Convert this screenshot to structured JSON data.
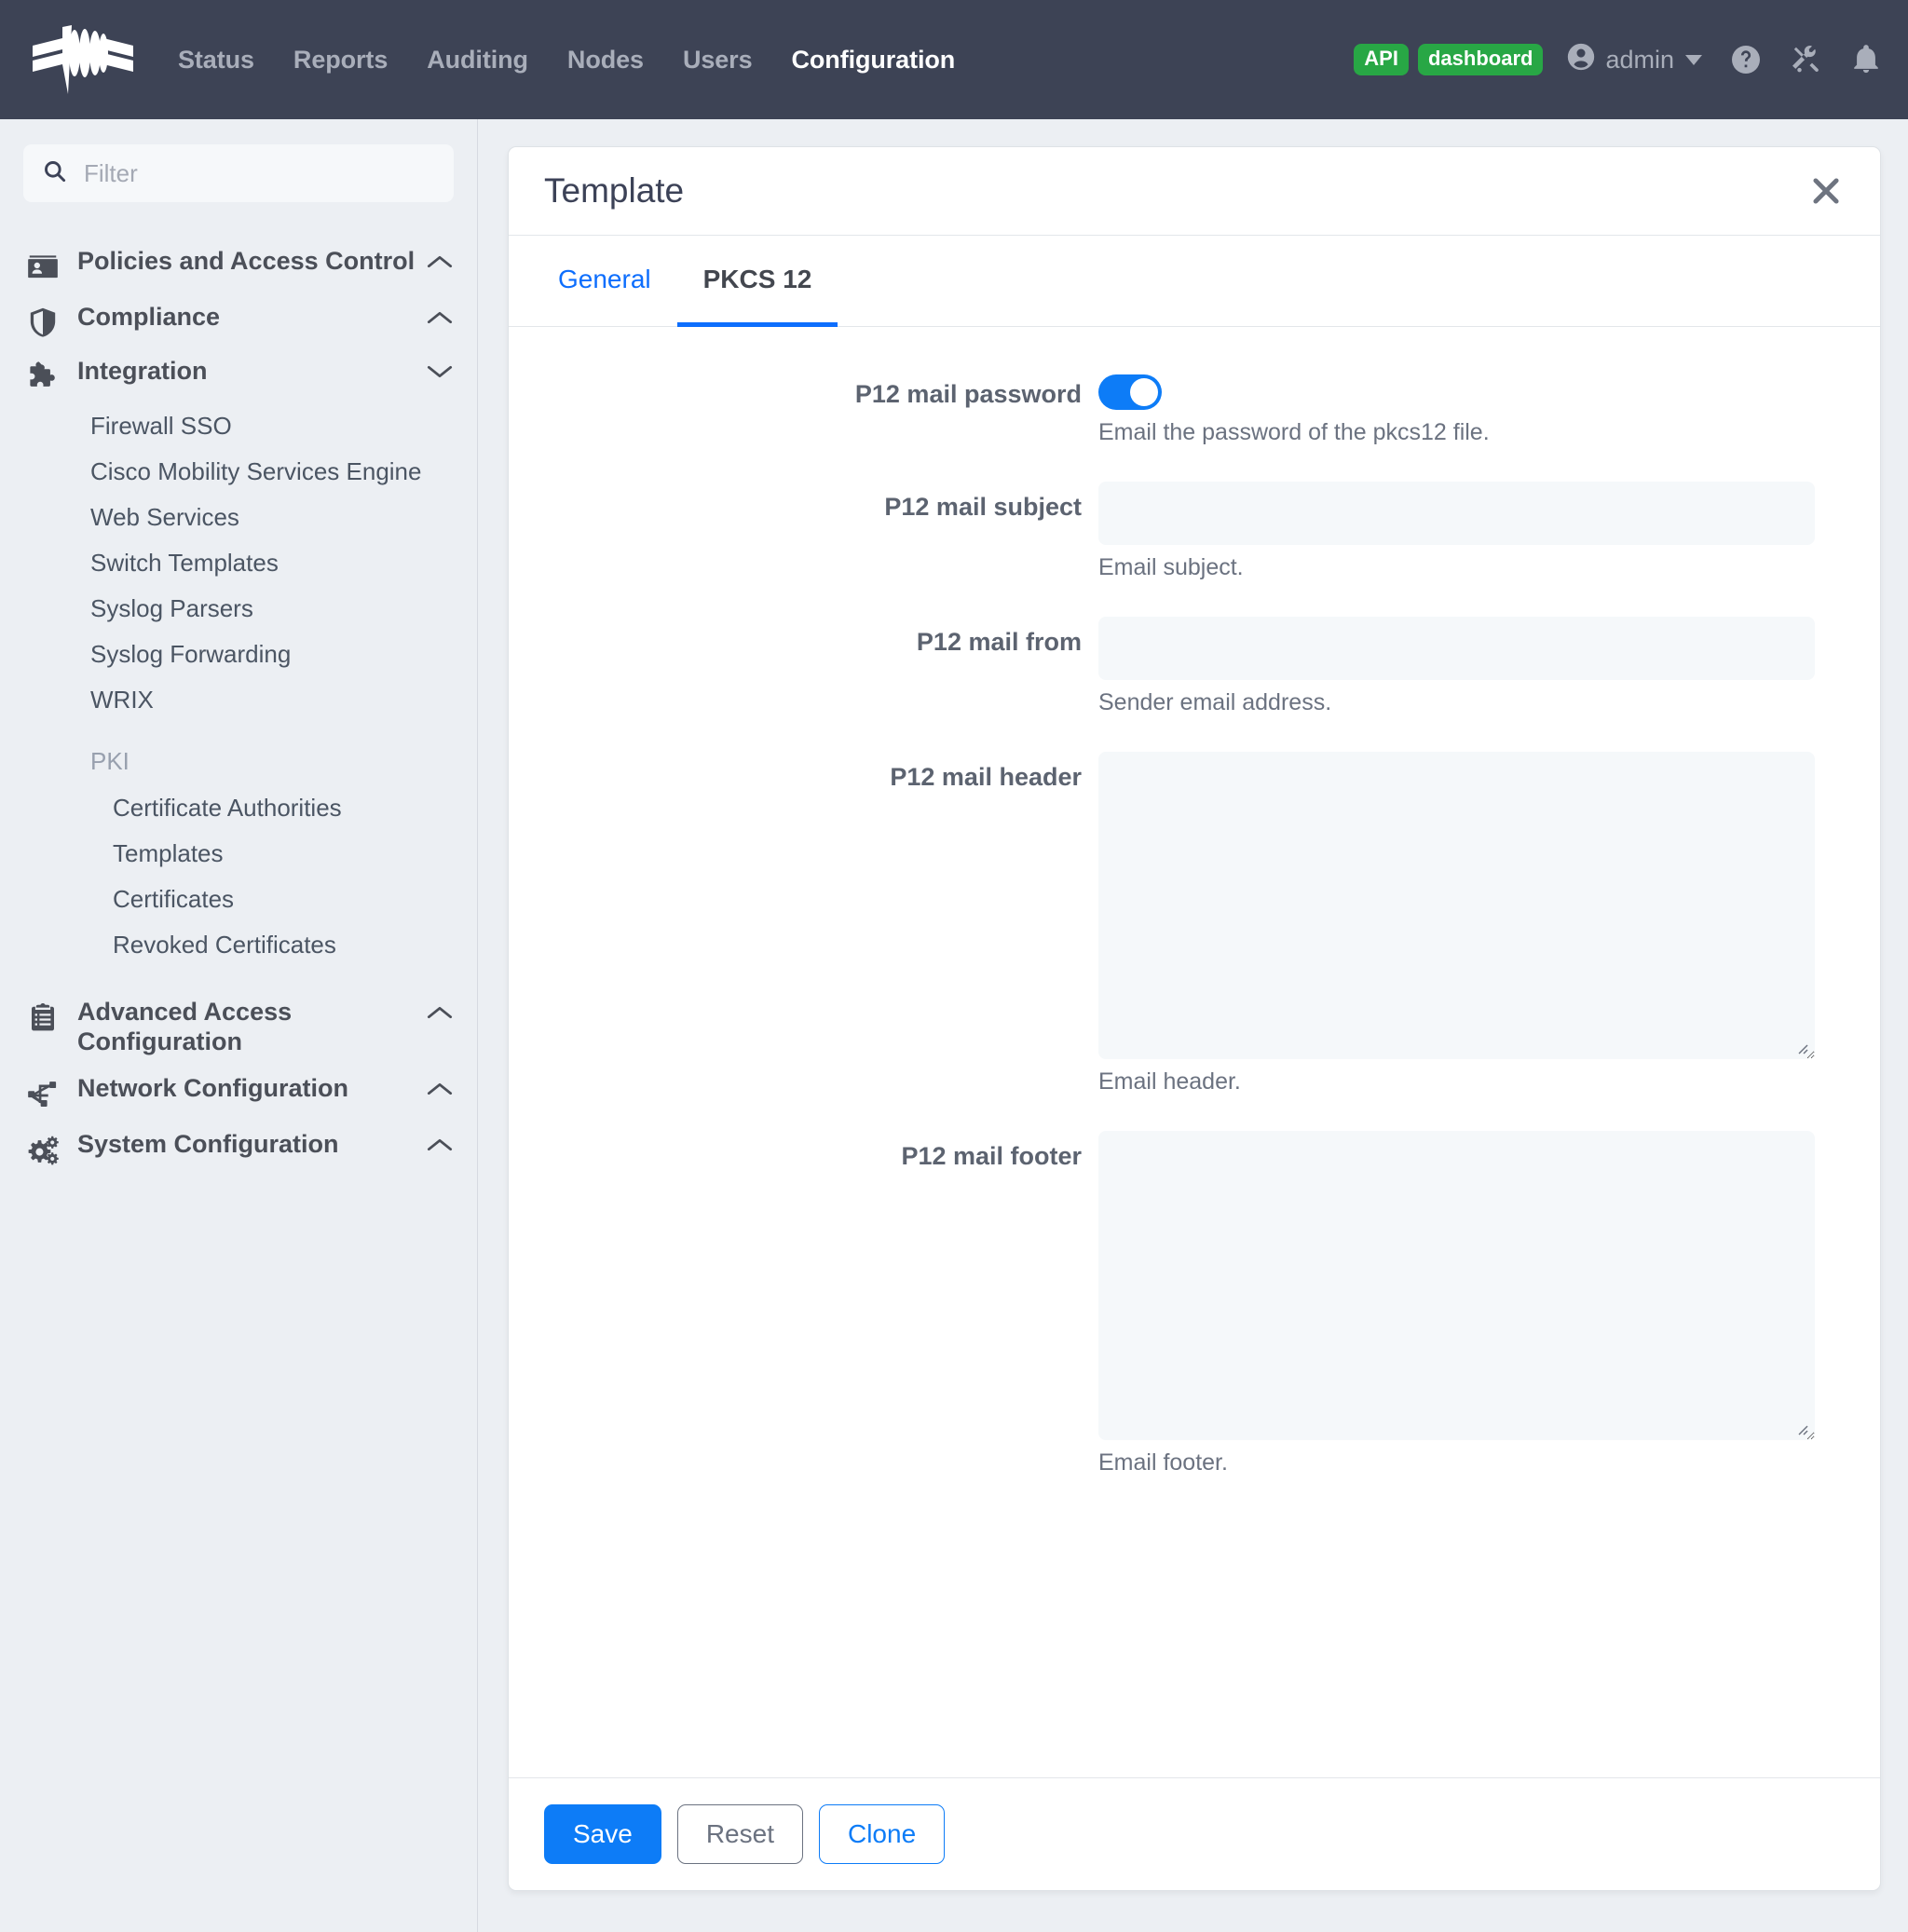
{
  "navbar": {
    "brand_icon": "logo-icon",
    "links": [
      {
        "label": "Status",
        "active": false
      },
      {
        "label": "Reports",
        "active": false
      },
      {
        "label": "Auditing",
        "active": false
      },
      {
        "label": "Nodes",
        "active": false
      },
      {
        "label": "Users",
        "active": false
      },
      {
        "label": "Configuration",
        "active": true
      }
    ],
    "badges": [
      {
        "label": "API",
        "color": "#28a745"
      },
      {
        "label": "dashboard",
        "color": "#28a745"
      }
    ],
    "user": "admin",
    "icons": [
      "help-circle-icon",
      "tools-icon",
      "bell-icon"
    ]
  },
  "sidebar": {
    "filter_placeholder": "Filter",
    "filter_value": "",
    "groups": [
      {
        "label": "Policies and Access Control",
        "icon": "id-card-icon",
        "chevron": "chevron-up-icon"
      },
      {
        "label": "Compliance",
        "icon": "shield-icon",
        "chevron": "chevron-up-icon"
      },
      {
        "label": "Integration",
        "icon": "puzzle-icon",
        "chevron": "chevron-down-icon"
      }
    ],
    "integration_items": [
      "Firewall SSO",
      "Cisco Mobility Services Engine",
      "Web Services",
      "Switch Templates",
      "Syslog Parsers",
      "Syslog Forwarding",
      "WRIX"
    ],
    "pki_section": "PKI",
    "pki_items": [
      "Certificate Authorities",
      "Templates",
      "Certificates",
      "Revoked Certificates"
    ],
    "bottom_groups": [
      {
        "label": "Advanced Access Configuration",
        "icon": "clipboard-list-icon",
        "chevron": "chevron-up-icon"
      },
      {
        "label": "Network Configuration",
        "icon": "network-icon",
        "chevron": "chevron-up-icon"
      },
      {
        "label": "System Configuration",
        "icon": "gears-icon",
        "chevron": "chevron-up-icon"
      }
    ]
  },
  "panel": {
    "title": "Template",
    "close_icon": "close-icon",
    "tabs": [
      {
        "label": "General",
        "active": false
      },
      {
        "label": "PKCS 12",
        "active": true
      }
    ],
    "fields": [
      {
        "label": "P12 mail password",
        "type": "toggle",
        "value": "on",
        "help": "Email the password of the pkcs12 file."
      },
      {
        "label": "P12 mail subject",
        "type": "text",
        "value": "",
        "help": "Email subject."
      },
      {
        "label": "P12 mail from",
        "type": "text",
        "value": "",
        "help": "Sender email address."
      },
      {
        "label": "P12 mail header",
        "type": "textarea",
        "value": "",
        "help": "Email header."
      },
      {
        "label": "P12 mail footer",
        "type": "textarea",
        "value": "",
        "help": "Email footer."
      }
    ],
    "buttons": [
      {
        "label": "Save",
        "style": "primary"
      },
      {
        "label": "Reset",
        "style": "secondary"
      },
      {
        "label": "Clone",
        "style": "outline"
      }
    ]
  },
  "colors": {
    "navbar_bg": "#3d4355",
    "accent": "#0d7cf7",
    "link": "#0d6efd",
    "badge_green": "#28a745",
    "page_bg": "#eceff3",
    "field_bg": "#f5f8fa"
  }
}
